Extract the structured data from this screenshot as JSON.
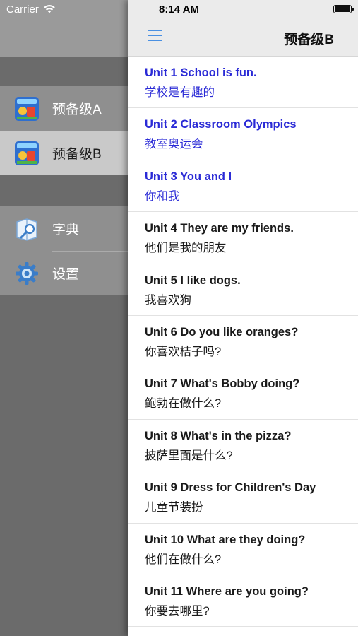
{
  "status_bar": {
    "carrier": "Carrier",
    "time": "8:14 AM"
  },
  "drawer": {
    "books": [
      {
        "label": "预备级A",
        "icon": "book-cover-icon",
        "selected": false
      },
      {
        "label": "预备级B",
        "icon": "book-cover-icon",
        "selected": true
      }
    ],
    "tools": [
      {
        "label": "字典",
        "icon": "dictionary-icon"
      },
      {
        "label": "设置",
        "icon": "gear-icon"
      }
    ]
  },
  "header": {
    "title": "预备级B",
    "menu_icon": "hamburger-menu-icon"
  },
  "units": [
    {
      "en": "Unit 1 School is fun.",
      "zh": "学校是有趣的",
      "highlighted": true
    },
    {
      "en": "Unit 2 Classroom Olympics",
      "zh": "教室奥运会",
      "highlighted": true
    },
    {
      "en": "Unit 3 You and I",
      "zh": "你和我",
      "highlighted": true
    },
    {
      "en": "Unit 4 They are my friends.",
      "zh": "他们是我的朋友",
      "highlighted": false
    },
    {
      "en": "Unit 5 I like dogs.",
      "zh": "我喜欢狗",
      "highlighted": false
    },
    {
      "en": "Unit 6 Do you like oranges?",
      "zh": "你喜欢桔子吗?",
      "highlighted": false
    },
    {
      "en": "Unit 7 What's Bobby doing?",
      "zh": "鲍勃在做什么?",
      "highlighted": false
    },
    {
      "en": "Unit 8 What's in the pizza?",
      "zh": "披萨里面是什么?",
      "highlighted": false
    },
    {
      "en": "Unit 9 Dress for Children's Day",
      "zh": "儿童节装扮",
      "highlighted": false
    },
    {
      "en": "Unit 10 What are they doing?",
      "zh": "他们在做什么?",
      "highlighted": false
    },
    {
      "en": "Unit 11 Where are you going?",
      "zh": "你要去哪里?",
      "highlighted": false
    }
  ],
  "colors": {
    "highlight": "#2a2ad6",
    "menu_accent": "#4a90e2"
  }
}
